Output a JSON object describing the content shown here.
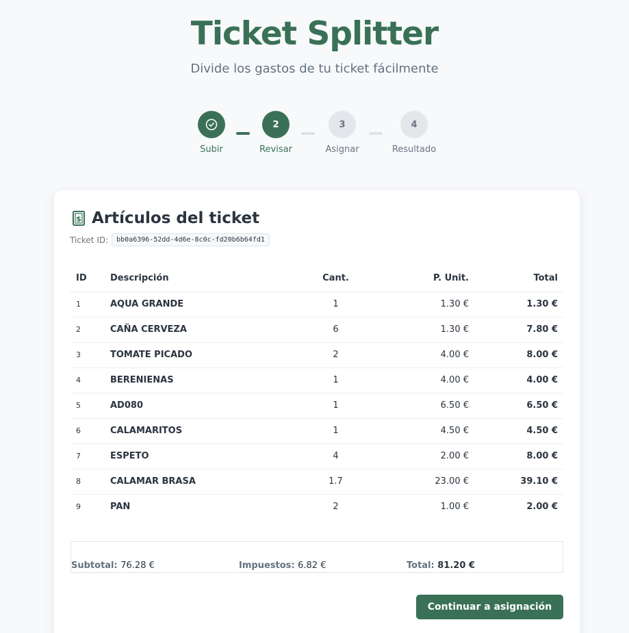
{
  "app": {
    "title": "Ticket Splitter",
    "subtitle": "Divide los gastos de tu ticket fácilmente"
  },
  "steps": [
    {
      "number": "1",
      "label": "Subir",
      "state": "done",
      "icon": "check-icon"
    },
    {
      "number": "2",
      "label": "Revisar",
      "state": "active"
    },
    {
      "number": "3",
      "label": "Asignar",
      "state": "todo"
    },
    {
      "number": "4",
      "label": "Resultado",
      "state": "todo"
    }
  ],
  "card": {
    "icon": "receipt-dollar-icon",
    "title": "Artículos del ticket",
    "ticket_id_label": "Ticket ID:",
    "ticket_id": "bb0a6396-52dd-4d6e-8c0c-fd20b6b64fd1"
  },
  "table": {
    "headers": {
      "id": "ID",
      "desc": "Descripción",
      "qty": "Cant.",
      "unit": "P. Unit.",
      "total": "Total"
    },
    "rows": [
      {
        "id": "1",
        "desc": "AQUA GRANDE",
        "qty": "1",
        "unit": "1.30 €",
        "total": "1.30 €"
      },
      {
        "id": "2",
        "desc": "CAÑA CERVEZA",
        "qty": "6",
        "unit": "1.30 €",
        "total": "7.80 €"
      },
      {
        "id": "3",
        "desc": "TOMATE PICADO",
        "qty": "2",
        "unit": "4.00 €",
        "total": "8.00 €"
      },
      {
        "id": "4",
        "desc": "BERENIENAS",
        "qty": "1",
        "unit": "4.00 €",
        "total": "4.00 €"
      },
      {
        "id": "5",
        "desc": "AD080",
        "qty": "1",
        "unit": "6.50 €",
        "total": "6.50 €"
      },
      {
        "id": "6",
        "desc": "CALAMARITOS",
        "qty": "1",
        "unit": "4.50 €",
        "total": "4.50 €"
      },
      {
        "id": "7",
        "desc": "ESPETO",
        "qty": "4",
        "unit": "2.00 €",
        "total": "8.00 €"
      },
      {
        "id": "8",
        "desc": "CALAMAR BRASA",
        "qty": "1.7",
        "unit": "23.00 €",
        "total": "39.10 €"
      },
      {
        "id": "9",
        "desc": "PAN",
        "qty": "2",
        "unit": "1.00 €",
        "total": "2.00 €"
      }
    ]
  },
  "summary": {
    "subtotal_label": "Subtotal:",
    "subtotal": "76.28 €",
    "tax_label": "Impuestos:",
    "tax": "6.82 €",
    "total_label": "Total:",
    "total": "81.20 €"
  },
  "actions": {
    "continue_label": "Continuar a asignación"
  },
  "colors": {
    "accent": "#3a7156",
    "muted": "#6b7480",
    "inactive_step": "#e3e6ea"
  }
}
